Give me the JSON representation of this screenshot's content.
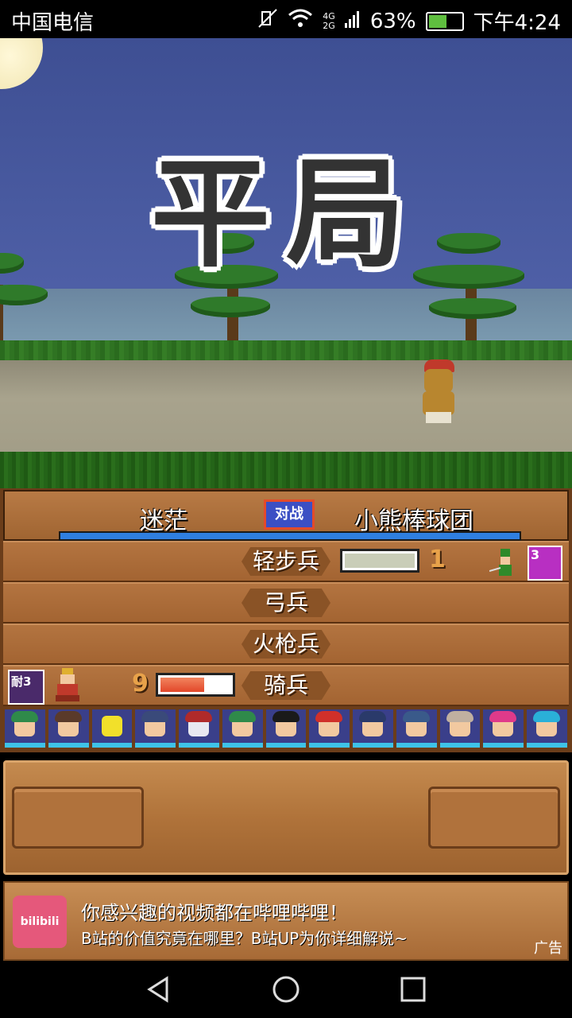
{
  "status_bar": {
    "carrier": "中国电信",
    "network": "4G\n2G",
    "battery_percent": "63%",
    "battery_level": 0.63,
    "time": "下午4:24"
  },
  "scene": {
    "result_text": "平局"
  },
  "battle": {
    "team_left": "迷茫",
    "vs_label": "对战",
    "team_right": "小熊棒球团",
    "rows": [
      {
        "label": "轻步兵",
        "count": "1",
        "gauge_level": 0.0,
        "side": "right"
      },
      {
        "label": "弓兵",
        "count": "",
        "side": "none"
      },
      {
        "label": "火枪兵",
        "count": "",
        "side": "none"
      },
      {
        "label": "骑兵",
        "count": "9",
        "gauge_level": 0.62,
        "side": "left"
      }
    ],
    "badge_left": "耐3",
    "badge_right": "3"
  },
  "ad": {
    "logo": "bilibili",
    "title": "你感兴趣的视频都在哔哩哔哩！",
    "subtitle": "B站的价值究竟在哪里？B站UP为你详细解说~",
    "tag": "广告"
  },
  "colors": {
    "sky": "#4e5fa6",
    "wood": "#b37440",
    "hp_blue": "#2f7fe0",
    "gauge_red": "#e2472a"
  }
}
